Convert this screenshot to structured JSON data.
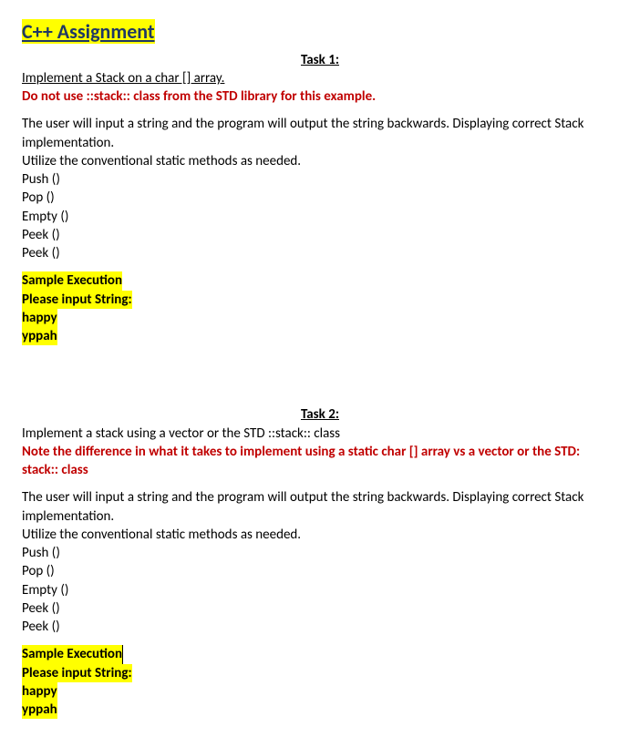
{
  "title": "C++ Assignment",
  "task1": {
    "heading": "Task 1:",
    "line1": "Implement a Stack on a char [] array.",
    "warning": " Do not use ::stack:: class from the STD library for this example.",
    "desc1": "The user will input a string and the program will output the string backwards. Displaying correct Stack implementation.",
    "desc2": "Utilize the conventional static methods as needed.",
    "methods": [
      "Push ()",
      "Pop ()",
      "Empty ()",
      "Peek ()",
      "Peek ()"
    ],
    "sample_label": "Sample Execution",
    "sample_prompt": "Please input String:",
    "sample_input": "happy",
    "sample_output": "yppah"
  },
  "task2": {
    "heading": "Task 2:",
    "line1": "Implement a stack using a vector or the STD ::stack:: class",
    "note": "Note the difference in what it takes to implement using a static char [] array vs a vector or the STD: stack:: class",
    "desc1": "The user will input a string and the program will output the string backwards. Displaying correct Stack implementation.",
    "desc2": "Utilize the conventional static methods as needed.",
    "methods": [
      "Push ()",
      "Pop ()",
      "Empty ()",
      "Peek ()",
      "Peek ()"
    ],
    "sample_label": "Sample Execution",
    "sample_prompt": "Please input String:",
    "sample_input": "happy",
    "sample_output": "yppah"
  }
}
